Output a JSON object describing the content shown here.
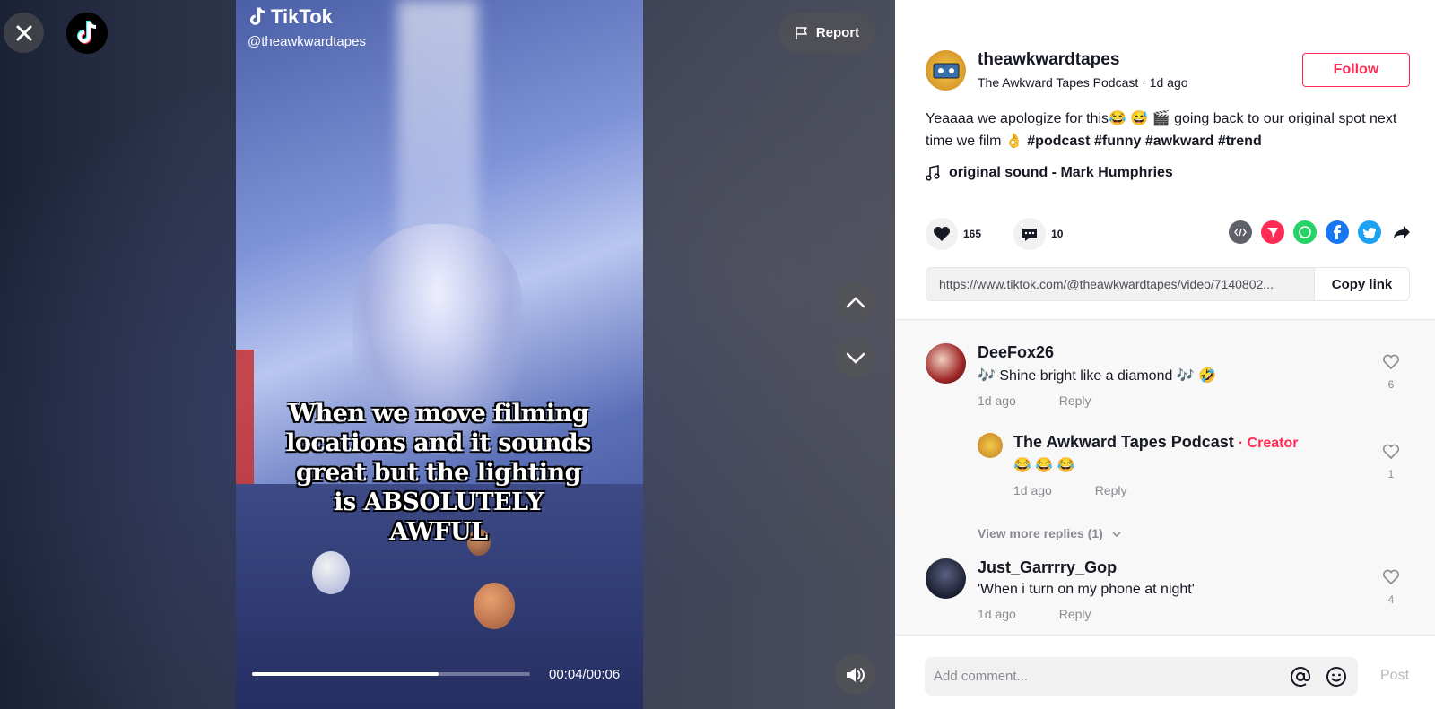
{
  "video": {
    "watermark_brand": "TikTok",
    "watermark_handle": "@theawkwardtapes",
    "caption": "When we move filming locations and it sounds great but the lighting is ABSOLUTELY AWFUL",
    "report_label": "Report",
    "time": "00:04/00:06",
    "progress_fraction": 0.67
  },
  "post": {
    "username": "theawkwardtapes",
    "display_name": "The Awkward Tapes Podcast",
    "time_ago": "1d ago",
    "follow_label": "Follow",
    "description": "Yeaaaa we apologize for this😂 😅 🎬 going back to our original spot next time we film 👌 ",
    "hashtags": [
      "#podcast",
      "#funny",
      "#awkward",
      "#trend"
    ],
    "music": "original sound - Mark Humphries",
    "likes": "165",
    "comments": "10",
    "url": "https://www.tiktok.com/@theawkwardtapes/video/7140802...",
    "copy_label": "Copy link"
  },
  "comments": [
    {
      "name": "DeeFox26",
      "text": "🎶 Shine bright like a diamond 🎶 🤣",
      "time": "1d ago",
      "reply": "Reply",
      "likes": "6"
    },
    {
      "name": "The Awkward Tapes Podcast",
      "creator_tag": "Creator",
      "text": "😂 😂 😂",
      "time": "1d ago",
      "reply": "Reply",
      "likes": "1"
    },
    {
      "name": "Just_Garrrry_Gop",
      "text": "'When i turn on my phone at night'",
      "time": "1d ago",
      "reply": "Reply",
      "likes": "4"
    }
  ],
  "view_more": "View more replies (1)",
  "comment_input": {
    "placeholder": "Add comment...",
    "post_label": "Post"
  },
  "colors": {
    "accent": "#fe2c55",
    "text": "#161823",
    "muted": "#8a8b91"
  }
}
